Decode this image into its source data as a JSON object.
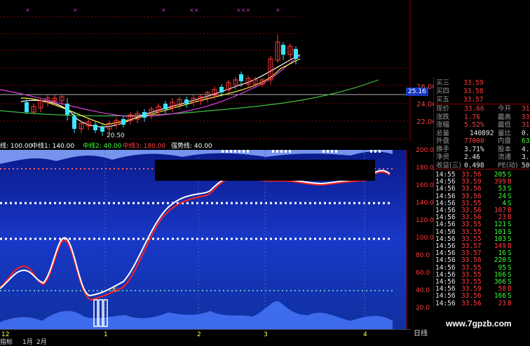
{
  "top_chart": {
    "price_levels": [
      "26.00",
      "24.00",
      "22.00"
    ],
    "current_price_tag": "25.16",
    "low_price_label": "20.50",
    "ma_colors": {
      "ma_white": "#ffffff",
      "ma_yellow": "#ffff40",
      "ma_magenta": "#ff40ff",
      "ma_green": "#40c040"
    }
  },
  "indicator": {
    "legend": [
      {
        "text": "线: 100.00",
        "color": "#ffffff"
      },
      {
        "text": "中线1: 140.00",
        "color": "#ffffff"
      },
      {
        "text": "中线2: 40.00",
        "color": "#40ff40"
      },
      {
        "text": "中线3: 180.00",
        "color": "#ff4040"
      },
      {
        "text": "强势线: 40.00",
        "color": "#ffffff"
      }
    ],
    "levels": [
      "200.0",
      "180.0",
      "160.0",
      "140.0",
      "120.0",
      "100.0",
      "80.0",
      "60.0",
      "40.0",
      "20.0"
    ]
  },
  "x_axis": {
    "labels": [
      "12",
      "1",
      "2",
      "3",
      "4"
    ],
    "period": "日线"
  },
  "bottom_tabs": [
    "指标",
    "1月",
    "2月"
  ],
  "quote": {
    "ask": [
      {
        "label": "买三",
        "price": "33.59",
        "vol": ""
      },
      {
        "label": "买四",
        "price": "33.58",
        "vol": ""
      },
      {
        "label": "买五",
        "price": "33.57",
        "vol": ""
      }
    ],
    "right_col_values": [
      "",
      "",
      ""
    ],
    "stats": [
      {
        "l1": "现价",
        "v1": "33.66",
        "l2": "今开",
        "v2": "31.8"
      },
      {
        "l1": "涨跌",
        "v1": "1.76",
        "l2": "最高",
        "v2": "33.8"
      },
      {
        "l1": "涨幅",
        "v1": "5.52%",
        "l2": "最低",
        "v2": "31.4"
      },
      {
        "l1": "总量",
        "v1": "140892",
        "l2": "量比",
        "v2": "0.9"
      },
      {
        "l1": "外盘",
        "v1": "77000",
        "l2": "内盘",
        "v2": "6380"
      },
      {
        "l1": "换手",
        "v1": "3.71%",
        "l2": "股本",
        "v2": "4.92"
      },
      {
        "l1": "净资",
        "v1": "2.46",
        "l2": "流通",
        "v2": "3.80"
      },
      {
        "l1": "收益(三)",
        "v1": "0.498",
        "l2": "PE(动)",
        "v2": "50"
      }
    ],
    "ticks": [
      {
        "time": "14:55",
        "price": "33.56",
        "vol": "205",
        "bs": "S"
      },
      {
        "time": "14:56",
        "price": "33.59",
        "vol": "399",
        "bs": "B"
      },
      {
        "time": "14:56",
        "price": "33.56",
        "vol": "53",
        "bs": "S"
      },
      {
        "time": "14:56",
        "price": "33.56",
        "vol": "24",
        "bs": "S"
      },
      {
        "time": "14:56",
        "price": "33.55",
        "vol": "4",
        "bs": "S"
      },
      {
        "time": "14:56",
        "price": "33.56",
        "vol": "107",
        "bs": "B"
      },
      {
        "time": "14:56",
        "price": "33.56",
        "vol": "23",
        "bs": "B"
      },
      {
        "time": "14:56",
        "price": "33.55",
        "vol": "121",
        "bs": "S"
      },
      {
        "time": "14:56",
        "price": "33.55",
        "vol": "101",
        "bs": "S"
      },
      {
        "time": "14:56",
        "price": "33.55",
        "vol": "103",
        "bs": "S"
      },
      {
        "time": "14:56",
        "price": "33.57",
        "vol": "149",
        "bs": "B"
      },
      {
        "time": "14:56",
        "price": "33.57",
        "vol": "16",
        "bs": "S"
      },
      {
        "time": "14:56",
        "price": "33.56",
        "vol": "220",
        "bs": "S"
      },
      {
        "time": "14:56",
        "price": "33.55",
        "vol": "95",
        "bs": "S"
      },
      {
        "time": "14:56",
        "price": "33.55",
        "vol": "166",
        "bs": "S"
      },
      {
        "time": "14:56",
        "price": "33.55",
        "vol": "366",
        "bs": "S"
      },
      {
        "time": "14:56",
        "price": "33.59",
        "vol": "58",
        "bs": "B"
      },
      {
        "time": "14:56",
        "price": "33.56",
        "vol": "166",
        "bs": "S"
      },
      {
        "time": "14:56",
        "price": "33.56",
        "vol": "23",
        "bs": "B"
      }
    ]
  },
  "watermark": "www.7gpzb.com",
  "colors": {
    "up": "#ff3c3c",
    "down": "#3cff3c",
    "indicator_bg": "#1638c8",
    "price_red": "#ff3c3c"
  }
}
